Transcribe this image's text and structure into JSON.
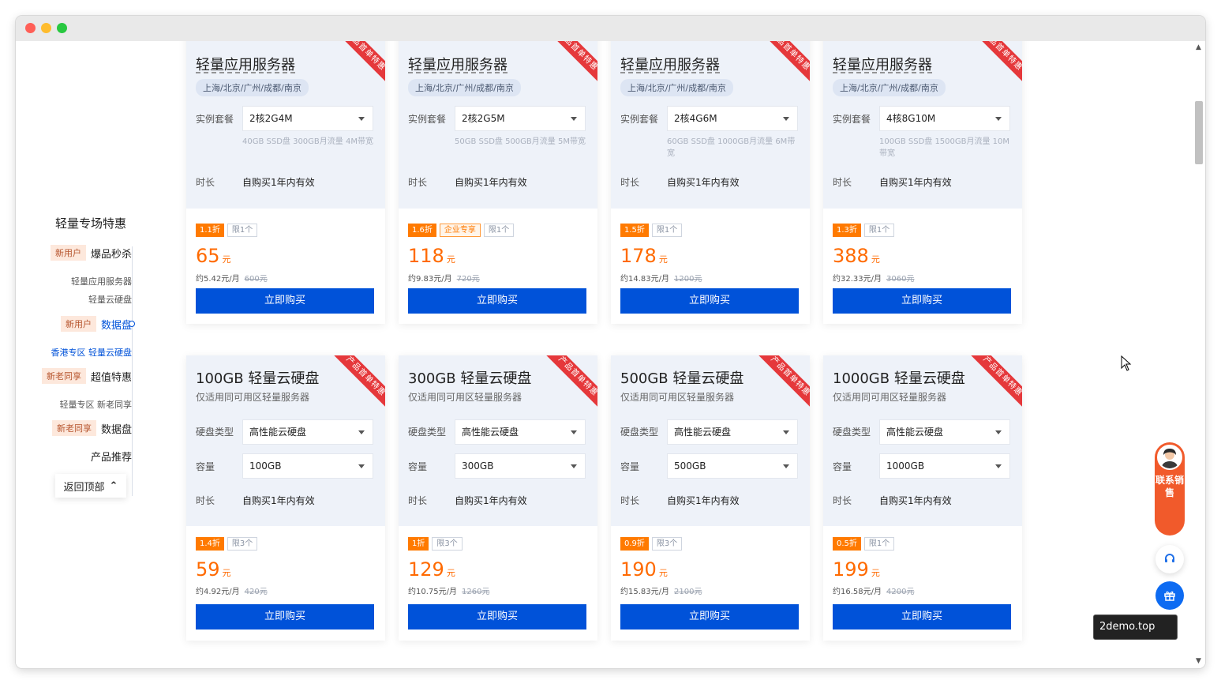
{
  "sidebar": {
    "title": "轻量专场特惠",
    "items": [
      {
        "badge": "新用户",
        "label": "爆品秒杀"
      },
      {
        "sub": "轻量应用服务器"
      },
      {
        "sub": "轻量云硬盘"
      },
      {
        "badge": "新用户",
        "label": "数据盘"
      },
      {
        "sub": "香港专区 轻量云硬盘"
      },
      {
        "badge": "新老同享",
        "label": "超值特惠"
      },
      {
        "sub": "轻量专区 新老同享"
      },
      {
        "badge": "新老同享",
        "label": "数据盘"
      },
      {
        "label": "产品推荐"
      }
    ],
    "back_top": "返回顶部"
  },
  "ribbon_text": "产品首单特惠",
  "server_cards": [
    {
      "title": "轻量应用服务器",
      "region": "上海/北京/广州/成都/南京",
      "plan_label": "实例套餐",
      "plan": "2核2G4M",
      "spec": "40GB SSD盘 300GB月流量 4M带宽",
      "duration_label": "时长",
      "duration": "自购买1年内有效",
      "discount": "1.1折",
      "enterprise": "",
      "limit": "限1个",
      "price": "65",
      "unit": "元",
      "per_month": "约5.42元/月",
      "original": "600元",
      "buy": "立即购买"
    },
    {
      "title": "轻量应用服务器",
      "region": "上海/北京/广州/成都/南京",
      "plan_label": "实例套餐",
      "plan": "2核2G5M",
      "spec": "50GB SSD盘 500GB月流量 5M带宽",
      "duration_label": "时长",
      "duration": "自购买1年内有效",
      "discount": "1.6折",
      "enterprise": "企业专享",
      "limit": "限1个",
      "price": "118",
      "unit": "元",
      "per_month": "约9.83元/月",
      "original": "720元",
      "buy": "立即购买"
    },
    {
      "title": "轻量应用服务器",
      "region": "上海/北京/广州/成都/南京",
      "plan_label": "实例套餐",
      "plan": "2核4G6M",
      "spec": "60GB SSD盘 1000GB月流量 6M带宽",
      "duration_label": "时长",
      "duration": "自购买1年内有效",
      "discount": "1.5折",
      "enterprise": "",
      "limit": "限1个",
      "price": "178",
      "unit": "元",
      "per_month": "约14.83元/月",
      "original": "1200元",
      "buy": "立即购买"
    },
    {
      "title": "轻量应用服务器",
      "region": "上海/北京/广州/成都/南京",
      "plan_label": "实例套餐",
      "plan": "4核8G10M",
      "spec": "100GB SSD盘 1500GB月流量 10M带宽",
      "duration_label": "时长",
      "duration": "自购买1年内有效",
      "discount": "1.3折",
      "enterprise": "",
      "limit": "限1个",
      "price": "388",
      "unit": "元",
      "per_month": "约32.33元/月",
      "original": "3060元",
      "buy": "立即购买"
    }
  ],
  "disk_cards": [
    {
      "title": "100GB 轻量云硬盘",
      "subtitle": "仅适用同可用区轻量服务器",
      "type_label": "硬盘类型",
      "type": "高性能云硬盘",
      "cap_label": "容量",
      "capacity": "100GB",
      "duration_label": "时长",
      "duration": "自购买1年内有效",
      "discount": "1.4折",
      "limit": "限3个",
      "price": "59",
      "unit": "元",
      "per_month": "约4.92元/月",
      "original": "420元",
      "buy": "立即购买"
    },
    {
      "title": "300GB 轻量云硬盘",
      "subtitle": "仅适用同可用区轻量服务器",
      "type_label": "硬盘类型",
      "type": "高性能云硬盘",
      "cap_label": "容量",
      "capacity": "300GB",
      "duration_label": "时长",
      "duration": "自购买1年内有效",
      "discount": "1折",
      "limit": "限3个",
      "price": "129",
      "unit": "元",
      "per_month": "约10.75元/月",
      "original": "1260元",
      "buy": "立即购买"
    },
    {
      "title": "500GB 轻量云硬盘",
      "subtitle": "仅适用同可用区轻量服务器",
      "type_label": "硬盘类型",
      "type": "高性能云硬盘",
      "cap_label": "容量",
      "capacity": "500GB",
      "duration_label": "时长",
      "duration": "自购买1年内有效",
      "discount": "0.9折",
      "limit": "限3个",
      "price": "190",
      "unit": "元",
      "per_month": "约15.83元/月",
      "original": "2100元",
      "buy": "立即购买"
    },
    {
      "title": "1000GB 轻量云硬盘",
      "subtitle": "仅适用同可用区轻量服务器",
      "type_label": "硬盘类型",
      "type": "高性能云硬盘",
      "cap_label": "容量",
      "capacity": "1000GB",
      "duration_label": "时长",
      "duration": "自购买1年内有效",
      "discount": "0.5折",
      "limit": "限1个",
      "price": "199",
      "unit": "元",
      "per_month": "约16.58元/月",
      "original": "4200元",
      "buy": "立即购买"
    }
  ],
  "tools": {
    "contact": "联系销售",
    "support_icon": "headset-icon",
    "gift_icon": "gift-icon"
  },
  "watermark": "2demo.top",
  "colors": {
    "primary": "#0052d9",
    "price": "#ff6a00",
    "ribbon": "#e5383b",
    "discount": "#ff7a00"
  }
}
